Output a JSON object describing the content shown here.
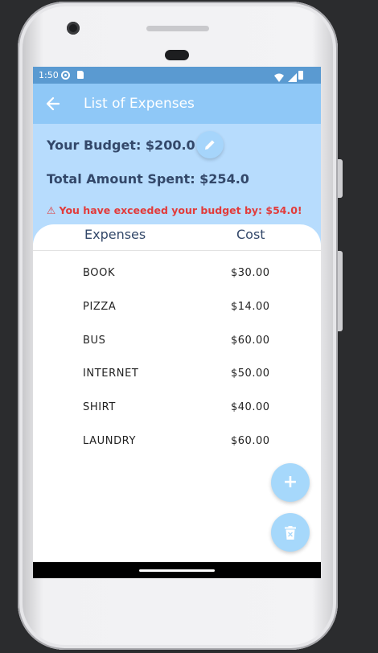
{
  "status_bar": {
    "time": "1:50",
    "icons": [
      "settings-icon",
      "sd-card-icon",
      "wifi-icon",
      "signal-icon",
      "battery-icon"
    ]
  },
  "app_bar": {
    "back_icon": "arrow-left-icon",
    "title": "List of Expenses"
  },
  "summary": {
    "budget_text": "Your Budget: $200.0",
    "total_spent_text": "Total Amount Spent: $254.0",
    "warning_text": "⚠ You have exceeded your budget by: $54.0!",
    "edit_icon": "pencil-icon"
  },
  "table": {
    "headers": [
      "Expenses",
      "Cost"
    ],
    "rows": [
      {
        "name": "BOOK",
        "cost": "$30.00"
      },
      {
        "name": "PIZZA",
        "cost": "$14.00"
      },
      {
        "name": "BUS",
        "cost": "$60.00"
      },
      {
        "name": "INTERNET",
        "cost": "$50.00"
      },
      {
        "name": "SHIRT",
        "cost": "$40.00"
      },
      {
        "name": "LAUNDRY",
        "cost": "$60.00"
      }
    ]
  },
  "fabs": {
    "add_icon": "plus-icon",
    "add_label": "+",
    "delete_icon": "trash-icon"
  },
  "colors": {
    "app_bar": "#8fc8f7",
    "status_bar": "#5a9ad1",
    "header_bg": "#b7dcfd",
    "heading_text": "#33486a",
    "warning": "#e23b3b",
    "fab": "#a6d8fb"
  }
}
